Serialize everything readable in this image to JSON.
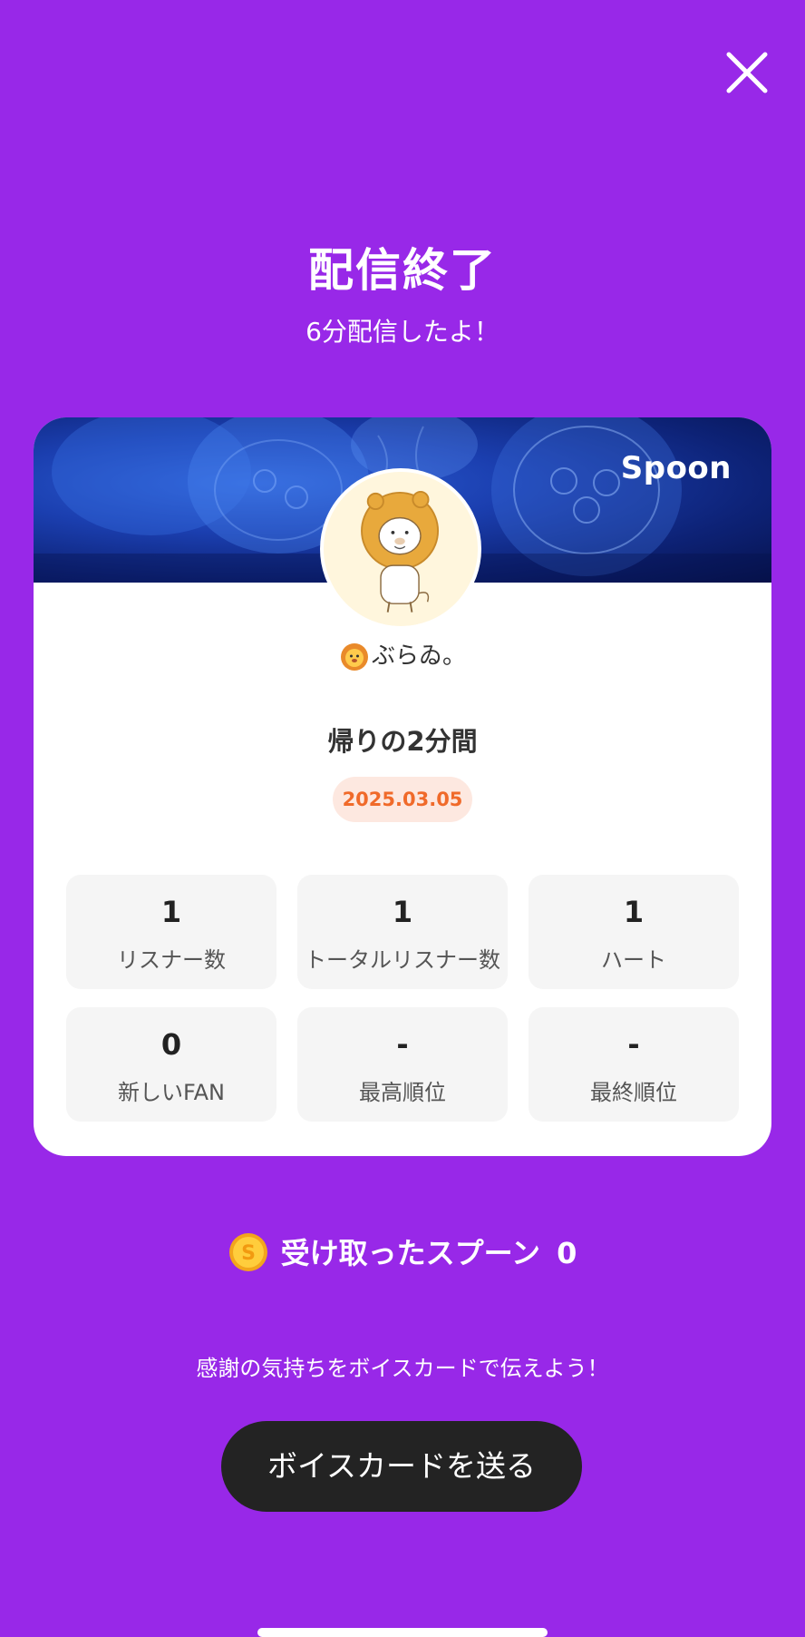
{
  "header": {
    "close_icon": "close-icon",
    "title": "配信終了",
    "subtitle": "6分配信したよ！"
  },
  "card": {
    "brand": "Spoon",
    "avatar": "lion-avatar",
    "username_emoji": "lion-face-icon",
    "username": "ぶらゐ。",
    "stream_title": "帰りの2分間",
    "date": "2025.03.05",
    "stats": [
      {
        "value": "1",
        "label": "リスナー数"
      },
      {
        "value": "1",
        "label": "トータルリスナー数"
      },
      {
        "value": "1",
        "label": "ハート"
      },
      {
        "value": "0",
        "label": "新しいFAN"
      },
      {
        "value": "-",
        "label": "最高順位"
      },
      {
        "value": "-",
        "label": "最終順位"
      }
    ]
  },
  "spoons": {
    "icon": "spoon-coin-icon",
    "label": "受け取ったスプーン",
    "count": "0"
  },
  "thanks_text": "感謝の気持ちをボイスカードで伝えよう！",
  "voice_card_button": "ボイスカードを送る",
  "colors": {
    "background": "#9828e8",
    "button": "#232323",
    "date_badge_text": "#f06a2a",
    "date_badge_bg": "#fde8e0"
  }
}
